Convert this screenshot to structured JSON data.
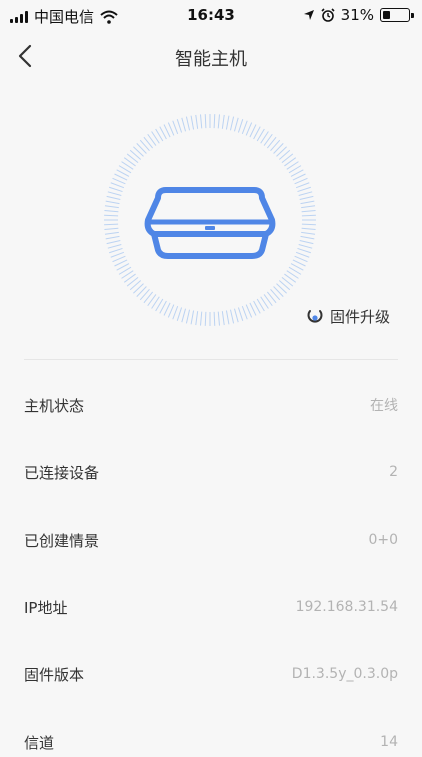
{
  "status_bar": {
    "carrier": "中国电信",
    "time": "16:43",
    "battery_percent": "31%",
    "battery_level": 0.31
  },
  "nav": {
    "title": "智能主机",
    "back_icon": "chevron-left-icon"
  },
  "device": {
    "icon": "hub-device-icon",
    "accent_color": "#4f86e6",
    "ring_color": "#bcd3f2"
  },
  "firmware_upgrade": {
    "label": "固件升级",
    "icon": "upgrade-progress-icon"
  },
  "info_rows": [
    {
      "label": "主机状态",
      "value": "在线"
    },
    {
      "label": "已连接设备",
      "value": "2"
    },
    {
      "label": "已创建情景",
      "value": "0+0"
    },
    {
      "label": "IP地址",
      "value": "192.168.31.54"
    },
    {
      "label": "固件版本",
      "value": "D1.3.5y_0.3.0p"
    },
    {
      "label": "信道",
      "value": "14"
    }
  ]
}
